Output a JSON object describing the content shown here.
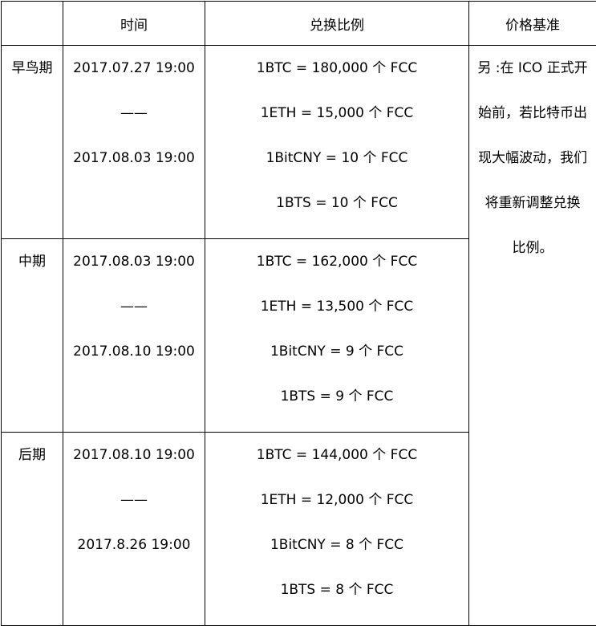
{
  "table": {
    "headers": [
      "",
      "时间",
      "兑换比例",
      "价格基准"
    ],
    "rows": [
      {
        "phase": "早鸟期",
        "time": [
          "2017.07.27 19:00",
          "——",
          "2017.08.03 19:00"
        ],
        "rates": [
          "1BTC = 180,000 个 FCC",
          "1ETH = 15,000  个 FCC",
          "1BitCNY = 10 个 FCC",
          "1BTS = 10 个 FCC"
        ]
      },
      {
        "phase": "中期",
        "time": [
          "2017.08.03 19:00",
          "——",
          "2017.08.10 19:00"
        ],
        "rates": [
          "1BTC = 162,000 个 FCC",
          "1ETH = 13,500 个 FCC",
          "1BitCNY = 9 个 FCC",
          "1BTS = 9 个 FCC"
        ]
      },
      {
        "phase": "后期",
        "time": [
          "2017.08.10 19:00",
          "——",
          "2017.8.26 19:00"
        ],
        "rates": [
          "1BTC = 144,000 个 FCC",
          "1ETH = 12,000 个 FCC",
          "1BitCNY = 8 个 FCC",
          "1BTS = 8 个 FCC"
        ]
      }
    ],
    "note_lines": [
      "另 :在 ICO 正式开",
      "始前，若比特币出",
      "现大幅波动，我们",
      "将重新调整兑换",
      "比例。"
    ]
  }
}
